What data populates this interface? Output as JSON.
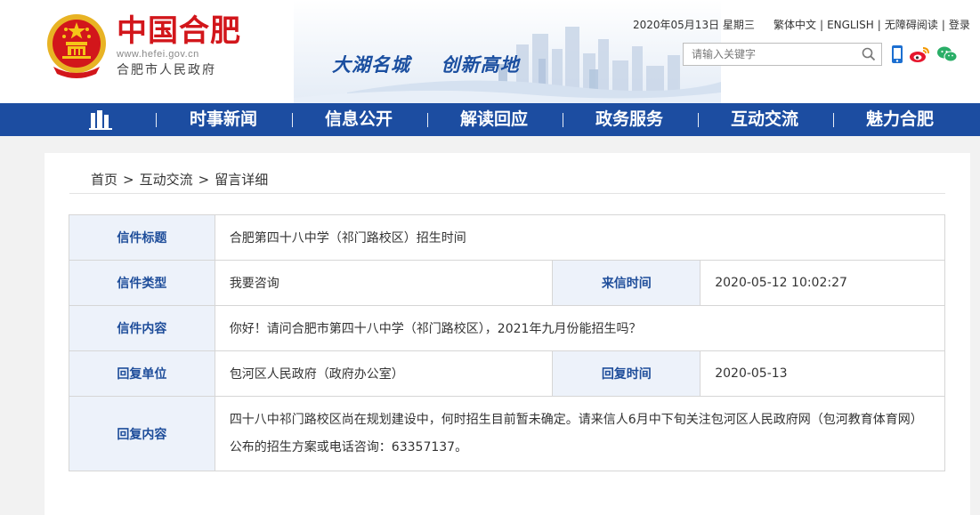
{
  "header": {
    "site_name": "中国合肥",
    "site_url": "www.hefei.gov.cn",
    "site_sub": "合肥市人民政府",
    "slogan_part1": "大湖名城",
    "slogan_part2": "创新高地",
    "date": "2020年05月13日 星期三",
    "links": [
      "繁体中文",
      "ENGLISH",
      "无障碍阅读",
      "登录"
    ],
    "search_placeholder": "请输入关键字"
  },
  "nav": {
    "items": [
      "时事新闻",
      "信息公开",
      "解读回应",
      "政务服务",
      "互动交流",
      "魅力合肥"
    ]
  },
  "breadcrumb": {
    "home": "首页",
    "section": "互动交流",
    "current": "留言详细",
    "separator": ">"
  },
  "letter": {
    "title_label": "信件标题",
    "title": "合肥第四十八中学（祁门路校区）招生时间",
    "type_label": "信件类型",
    "type": "我要咨询",
    "received_label": "来信时间",
    "received": "2020-05-12 10:02:27",
    "content_label": "信件内容",
    "content": "你好！请问合肥市第四十八中学（祁门路校区），2021年九月份能招生吗？",
    "reply_unit_label": "回复单位",
    "reply_unit": "包河区人民政府（政府办公室）",
    "reply_time_label": "回复时间",
    "reply_time": "2020-05-13",
    "reply_content_label": "回复内容",
    "reply_content": "四十八中祁门路校区尚在规划建设中，何时招生目前暂未确定。请来信人6月中下旬关注包河区人民政府网（包河教育体育网）公布的招生方案或电话咨询：63357137。"
  },
  "colors": {
    "brand_red": "#d2161b",
    "nav_blue": "#1c4da1",
    "label_bg": "#edf2fa",
    "label_text": "#1e4d9a"
  }
}
